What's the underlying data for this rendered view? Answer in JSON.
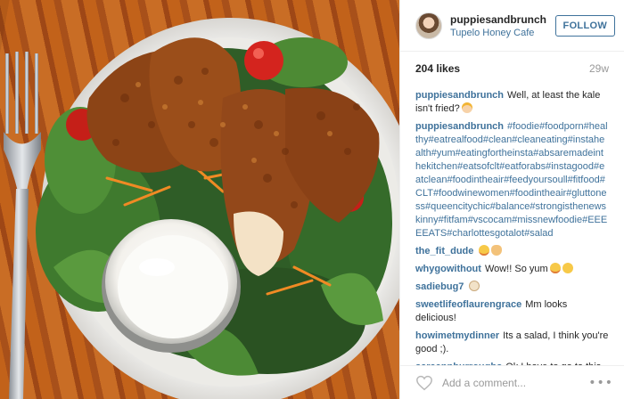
{
  "post": {
    "image_alt": "Fried chicken kale salad with ranch dressing",
    "author": {
      "username": "puppiesandbrunch",
      "location": "Tupelo Honey Cafe"
    },
    "follow_label": "FOLLOW",
    "likes": "204 likes",
    "age": "29w",
    "caption": {
      "username": "puppiesandbrunch",
      "text": "Well, at least the kale isn't fried?",
      "emoji": "woman-shrugging-icon"
    },
    "comments": [
      {
        "username": "puppiesandbrunch",
        "text": "#foodie#foodporn#healthy#eatrealfood#clean#cleaneating#instahealth#yum#eatingfortheinsta#absaremadeinthekitchen#eatsofclt#eatforabs#instagood#eatclean#foodintheair#feedyoursoull#fitfood#CLT#foodwinewomen#foodintheair#gluttoness#queencitychic#balance#strongisthenewskinny#fitfam#vscocam#missnewfoodie#EEEEEATS#charlottesgotalot#salad",
        "is_tags": true,
        "emoji": []
      },
      {
        "username": "the_fit_dude",
        "text": "",
        "is_tags": false,
        "emoji": [
          "grinning-face-icon",
          "ok-hand-icon"
        ]
      },
      {
        "username": "whygowithout",
        "text": "Wow!! So yum",
        "is_tags": false,
        "emoji": [
          "grimacing-face-icon",
          "smiling-face-icon"
        ]
      },
      {
        "username": "sadiebug7",
        "text": "",
        "is_tags": false,
        "emoji": [
          "dog-face-icon"
        ]
      },
      {
        "username": "sweetlifeoflaurengrace",
        "text": "Mm looks delicious!",
        "is_tags": false,
        "emoji": []
      },
      {
        "username": "howimetmydinner",
        "text": "Its a salad, I think you're good ;).",
        "is_tags": false,
        "emoji": []
      },
      {
        "username": "saraannburroughs",
        "text": "Ok I have to go to this place this week",
        "is_tags": false,
        "emoji": [
          "heart-eyes-icon",
          "heart-eyes-icon"
        ]
      }
    ],
    "comment_placeholder": "Add a comment...",
    "more_label": "•••",
    "colors": {
      "link": "#3f729b",
      "text": "#262626",
      "muted": "#999999",
      "divider": "#efefef"
    }
  }
}
